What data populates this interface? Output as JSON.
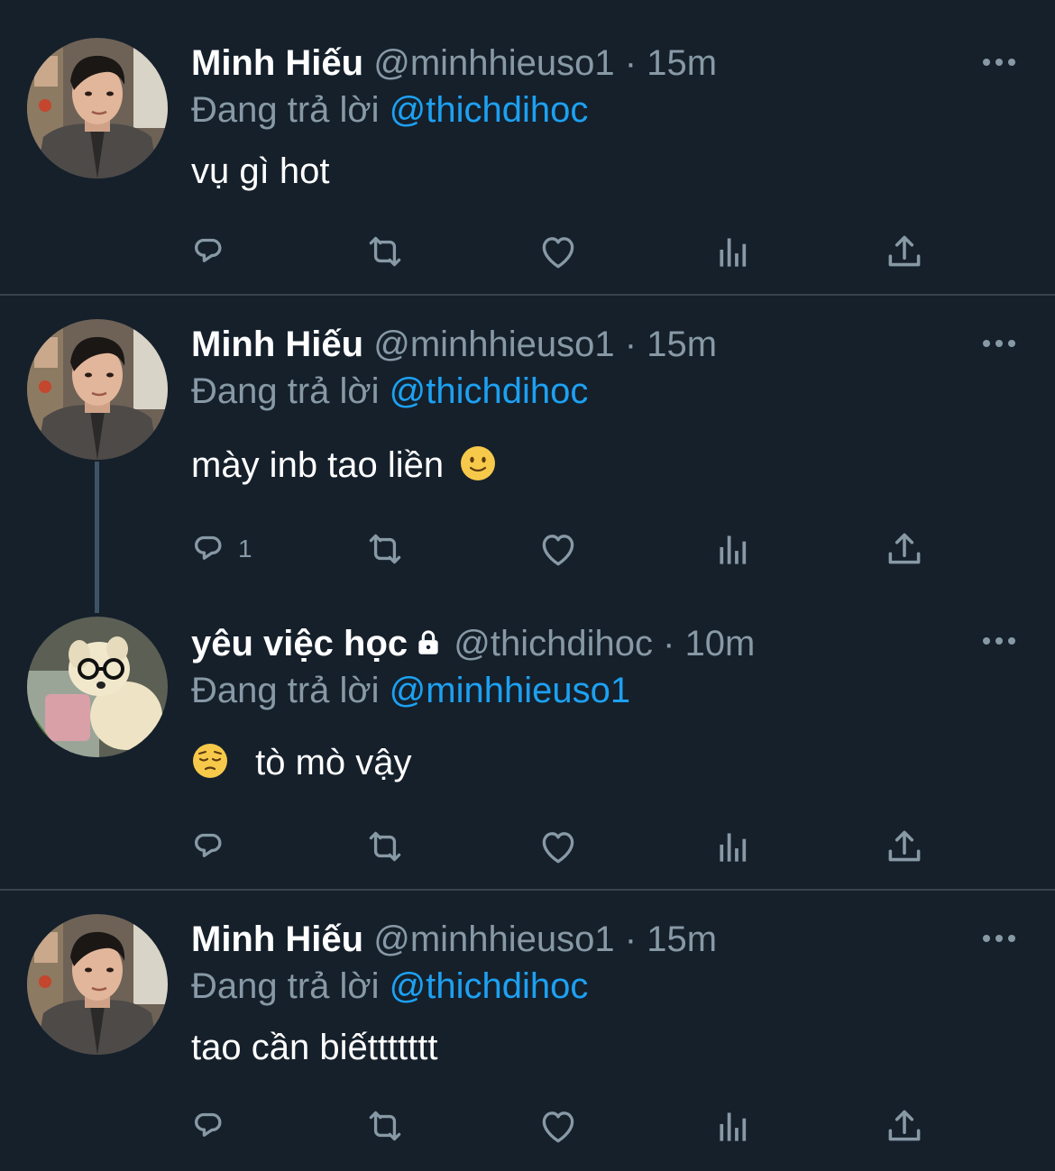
{
  "tweets": [
    {
      "name": "Minh Hiếu",
      "handle": "@minhhieuso1",
      "separator": "·",
      "time": "15m",
      "reply_prefix": "Đang trả lời",
      "reply_to": "@thichdihoc",
      "text": "vụ gì hot",
      "reply_count": ""
    },
    {
      "name": "Minh Hiếu",
      "handle": "@minhhieuso1",
      "separator": "·",
      "time": "15m",
      "reply_prefix": "Đang trả lời",
      "reply_to": "@thichdihoc",
      "text": "mày inb tao liền",
      "text_emoji": "slightly-smiling-face",
      "reply_count": "1"
    },
    {
      "name": "yêu việc học",
      "locked": true,
      "handle": "@thichdihoc",
      "separator": "·",
      "time": "10m",
      "reply_prefix": "Đang trả lời",
      "reply_to": "@minhhieuso1",
      "text": "tò mò vậy",
      "text_emoji": "pensive-face",
      "reply_count": ""
    },
    {
      "name": "Minh Hiếu",
      "handle": "@minhhieuso1",
      "separator": "·",
      "time": "15m",
      "reply_prefix": "Đang trả lời",
      "reply_to": "@thichdihoc",
      "text": "tao cần biếttttttt",
      "reply_count": ""
    }
  ],
  "icons": [
    "reply-icon",
    "retweet-icon",
    "like-icon",
    "analytics-icon",
    "share-icon",
    "more-icon",
    "lock-icon"
  ],
  "colors": {
    "background": "#15202b",
    "divider": "#38444d",
    "secondary_text": "#8899a6",
    "mention": "#1da1f2",
    "primary_text": "#ffffff"
  }
}
